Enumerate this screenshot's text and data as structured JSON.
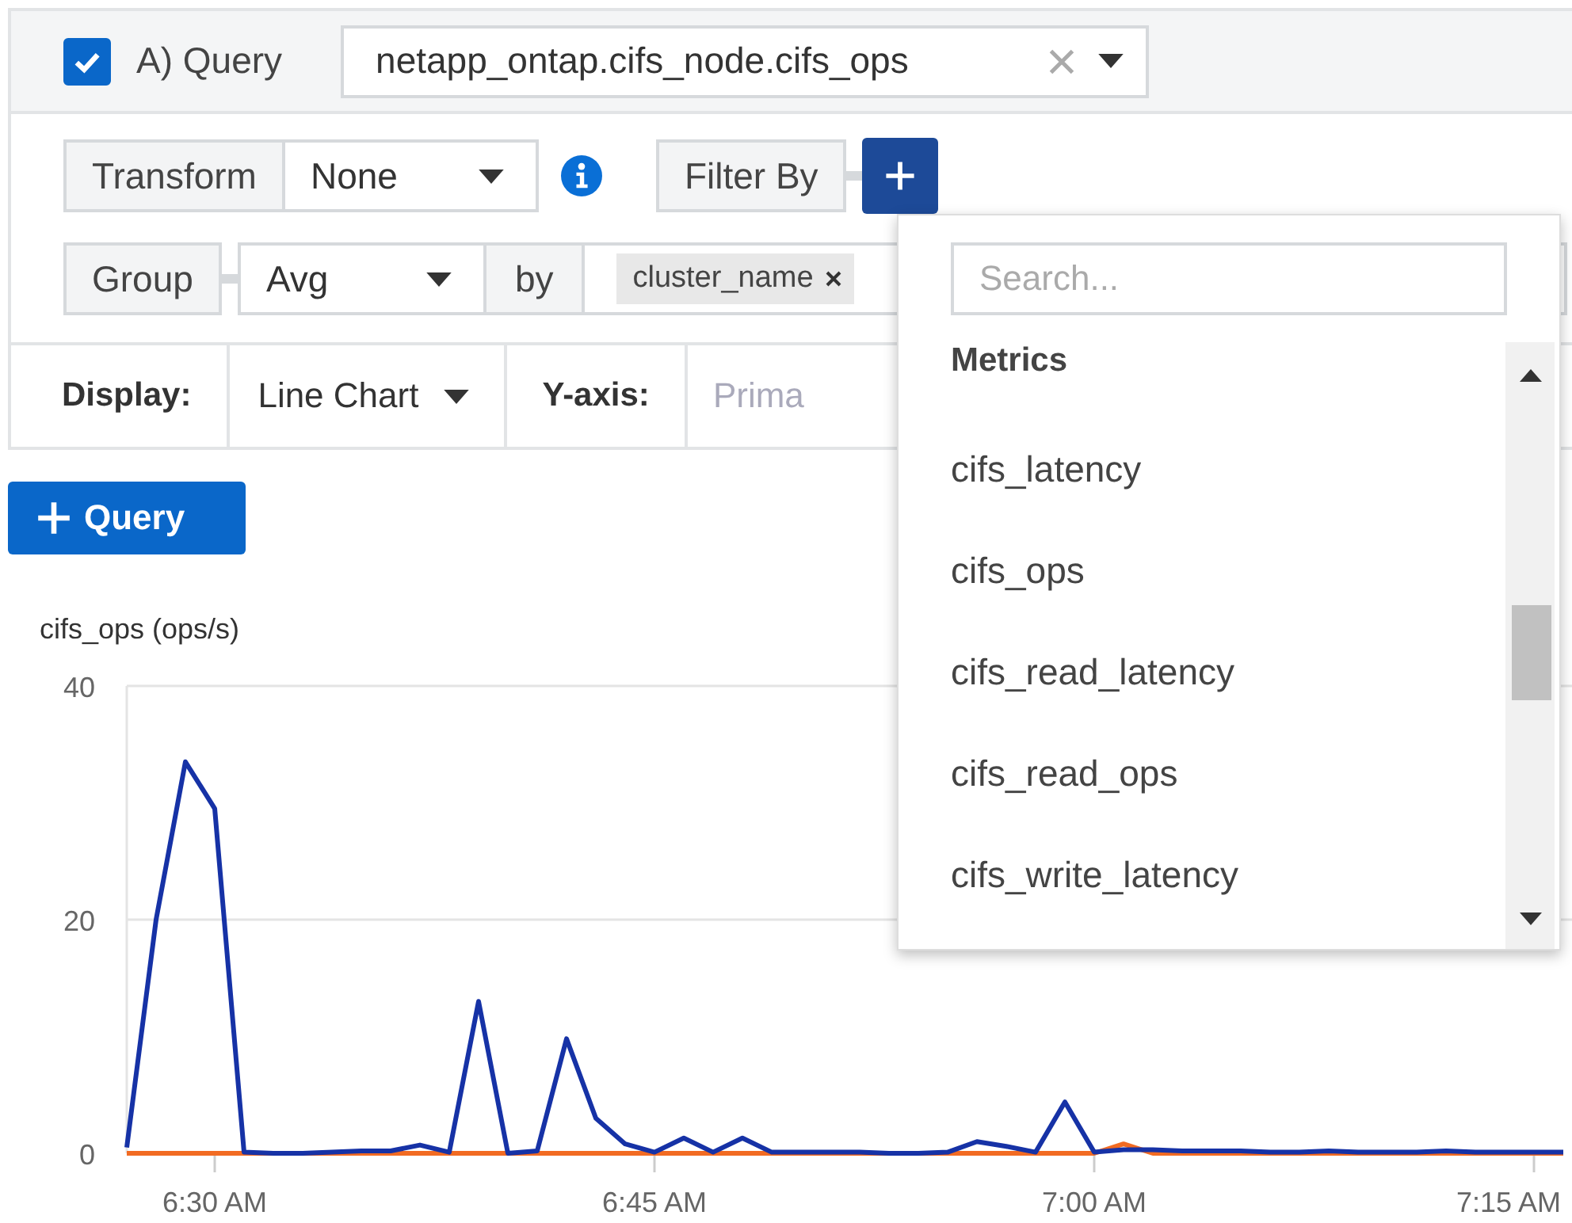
{
  "query": {
    "enabled": true,
    "label": "A) Query",
    "metric": "netapp_ontap.cifs_node.cifs_ops"
  },
  "transform": {
    "label": "Transform",
    "value": "None"
  },
  "filter": {
    "label": "Filter By"
  },
  "group": {
    "label": "Group",
    "value": "Avg",
    "by_label": "by",
    "tags": [
      "cluster_name"
    ]
  },
  "display": {
    "label": "Display:",
    "value": "Line Chart",
    "yaxis_label": "Y-axis:",
    "yaxis_placeholder": "Prima"
  },
  "add_query_button": {
    "label": "Query"
  },
  "dropdown": {
    "search_placeholder": "Search...",
    "section": "Metrics",
    "items": [
      "cifs_latency",
      "cifs_ops",
      "cifs_read_latency",
      "cifs_read_ops",
      "cifs_write_latency"
    ]
  },
  "chart": {
    "chart_data": {
      "type": "line",
      "ylabel": "cifs_ops (ops/s)",
      "ylim": [
        0,
        40
      ],
      "yticks": [
        0,
        20,
        40
      ],
      "categories": [
        null,
        null,
        null,
        "6:30 AM",
        null,
        null,
        null,
        null,
        null,
        null,
        null,
        null,
        null,
        null,
        null,
        null,
        null,
        null,
        "6:45 AM",
        null,
        null,
        null,
        null,
        null,
        null,
        null,
        null,
        null,
        null,
        null,
        null,
        null,
        null,
        "7:00 AM",
        null,
        null,
        null,
        null,
        null,
        null,
        null,
        null,
        null,
        null,
        null,
        null,
        null,
        null,
        "7:15 AM",
        null
      ],
      "series": [
        {
          "color": "#1632a6",
          "values": [
            0.5,
            20,
            33.5,
            29.5,
            0.1,
            0,
            0,
            0.1,
            0.2,
            0.2,
            0.7,
            0.1,
            13,
            0,
            0.2,
            9.8,
            3,
            0.8,
            0.1,
            1.3,
            0.1,
            1.3,
            0.1,
            0.1,
            0.1,
            0.1,
            0,
            0,
            0.1,
            1,
            0.6,
            0.1,
            4.4,
            0.1,
            0.3,
            0.3,
            0.2,
            0.2,
            0.2,
            0.1,
            0.1,
            0.2,
            0.1,
            0.1,
            0.1,
            0.2,
            0.1,
            0.1,
            0.1,
            0.1
          ]
        },
        {
          "color": "#f26b22",
          "values": [
            0,
            0,
            0,
            0,
            0,
            0,
            0,
            0,
            0,
            0,
            0,
            0,
            0,
            0,
            0,
            0,
            0,
            0,
            0,
            0,
            0,
            0,
            0,
            0,
            0,
            0,
            0,
            0,
            0,
            0,
            0,
            0,
            0,
            0,
            0.8,
            0,
            0,
            0,
            0,
            0,
            0,
            0,
            0,
            0,
            0,
            0,
            0,
            0,
            0,
            0
          ]
        }
      ]
    }
  }
}
